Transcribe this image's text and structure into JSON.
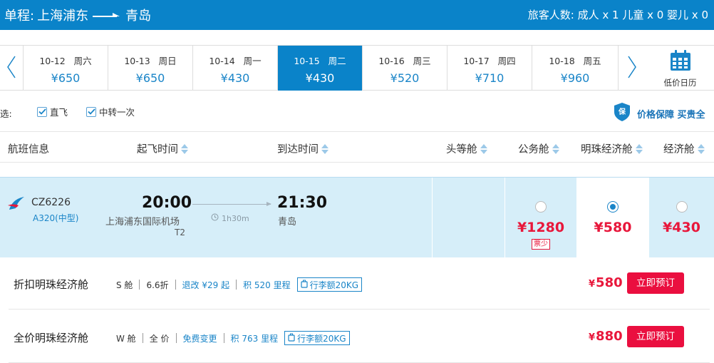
{
  "header": {
    "route_prefix": "单程:",
    "origin": "上海浦东",
    "destination": "青岛",
    "passengers": "旅客人数: 成人 x 1 儿童 x 0 婴儿 x 0"
  },
  "dates": [
    {
      "date": "10-12",
      "weekday": "周六",
      "price": "¥650",
      "active": false
    },
    {
      "date": "10-13",
      "weekday": "周日",
      "price": "¥650",
      "active": false
    },
    {
      "date": "10-14",
      "weekday": "周一",
      "price": "¥430",
      "active": false
    },
    {
      "date": "10-15",
      "weekday": "周二",
      "price": "¥430",
      "active": true
    },
    {
      "date": "10-16",
      "weekday": "周三",
      "price": "¥520",
      "active": false
    },
    {
      "date": "10-17",
      "weekday": "周四",
      "price": "¥710",
      "active": false
    },
    {
      "date": "10-18",
      "weekday": "周五",
      "price": "¥960",
      "active": false
    }
  ],
  "calendar_label": "低价日历",
  "filter": {
    "label": "选:",
    "direct_label": "直飞",
    "direct_checked": true,
    "transfer_label": "中转一次",
    "transfer_checked": true,
    "guarantee_text": "价格保障 买贵全"
  },
  "columns": {
    "flight_info": "航班信息",
    "depart_time": "起飞时间",
    "arrive_time": "到达时间",
    "first": "头等舱",
    "business": "公务舱",
    "pearl_economy": "明珠经济舱",
    "economy": "经济舱"
  },
  "flight": {
    "number": "CZ6226",
    "aircraft": "A320(中型)",
    "depart_time": "20:00",
    "depart_airport": "上海浦东国际机场",
    "depart_terminal": "T2",
    "duration": "1h30m",
    "arrive_time": "21:30",
    "arrive_airport": "青岛",
    "fares": [
      {
        "cabin": "business",
        "price": "¥1280",
        "tag": "票少",
        "selected": false
      },
      {
        "cabin": "pearl_economy",
        "price": "¥580",
        "tag": "",
        "selected": true
      },
      {
        "cabin": "economy",
        "price": "¥430",
        "tag": "",
        "selected": false
      }
    ]
  },
  "cabin_options": [
    {
      "name": "折扣明珠经济舱",
      "class_code": "S 舱",
      "discount": "6.6折",
      "change_rule": "退改 ¥29 起",
      "mileage": "积 520 里程",
      "baggage": "行李额20KG",
      "currency": "¥",
      "price": "580",
      "book_label": "立即预订"
    },
    {
      "name": "全价明珠经济舱",
      "class_code": "W 舱",
      "discount": "全 价",
      "change_rule": "免费变更",
      "mileage": "积 763 里程",
      "baggage": "行李额20KG",
      "currency": "¥",
      "price": "880",
      "book_label": "立即预订"
    }
  ],
  "colors": {
    "brand_blue": "#0a83c9",
    "price_red": "#e8173b",
    "row_highlight": "#d6eef9"
  }
}
